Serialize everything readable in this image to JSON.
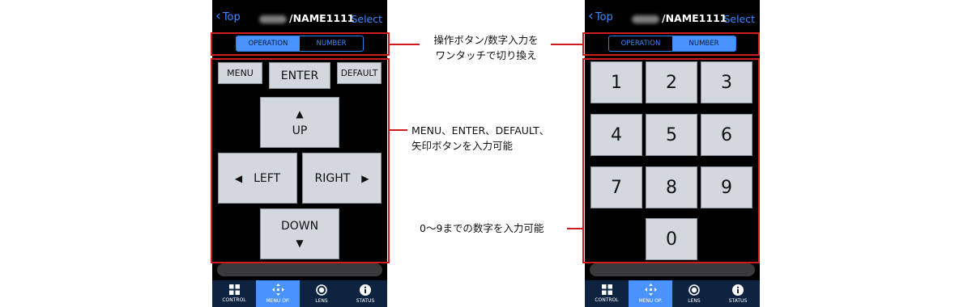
{
  "header": {
    "back_label": "Top",
    "title": "/NAME1111",
    "select_label": "Select"
  },
  "mode_tabs": {
    "operation": "OPERATION",
    "number": "NUMBER"
  },
  "operation_keys": {
    "menu": "MENU",
    "enter": "ENTER",
    "default": "DEFAULT",
    "up": "UP",
    "left": "LEFT",
    "right": "RIGHT",
    "down": "DOWN"
  },
  "number_keys": [
    "1",
    "2",
    "3",
    "4",
    "5",
    "6",
    "7",
    "8",
    "9",
    "0"
  ],
  "bottom_tabs": [
    {
      "label": "CONTROL",
      "icon": "grid-icon"
    },
    {
      "label": "MENU OP.",
      "icon": "move-arrows-icon",
      "active": true
    },
    {
      "label": "LENS",
      "icon": "lens-icon"
    },
    {
      "label": "STATUS",
      "icon": "info-icon"
    }
  ],
  "annotations": {
    "mode_switch": [
      "操作ボタン/数字入力を",
      "ワンタッチで切り換え"
    ],
    "operation": [
      "MENU、ENTER、DEFAULT、",
      "矢印ボタンを入力可能"
    ],
    "number": "0〜9までの数字を入力可能"
  },
  "colors": {
    "accent": "#4a93ff",
    "highlight": "#d01c1c",
    "tabbar": "#0d2340"
  }
}
